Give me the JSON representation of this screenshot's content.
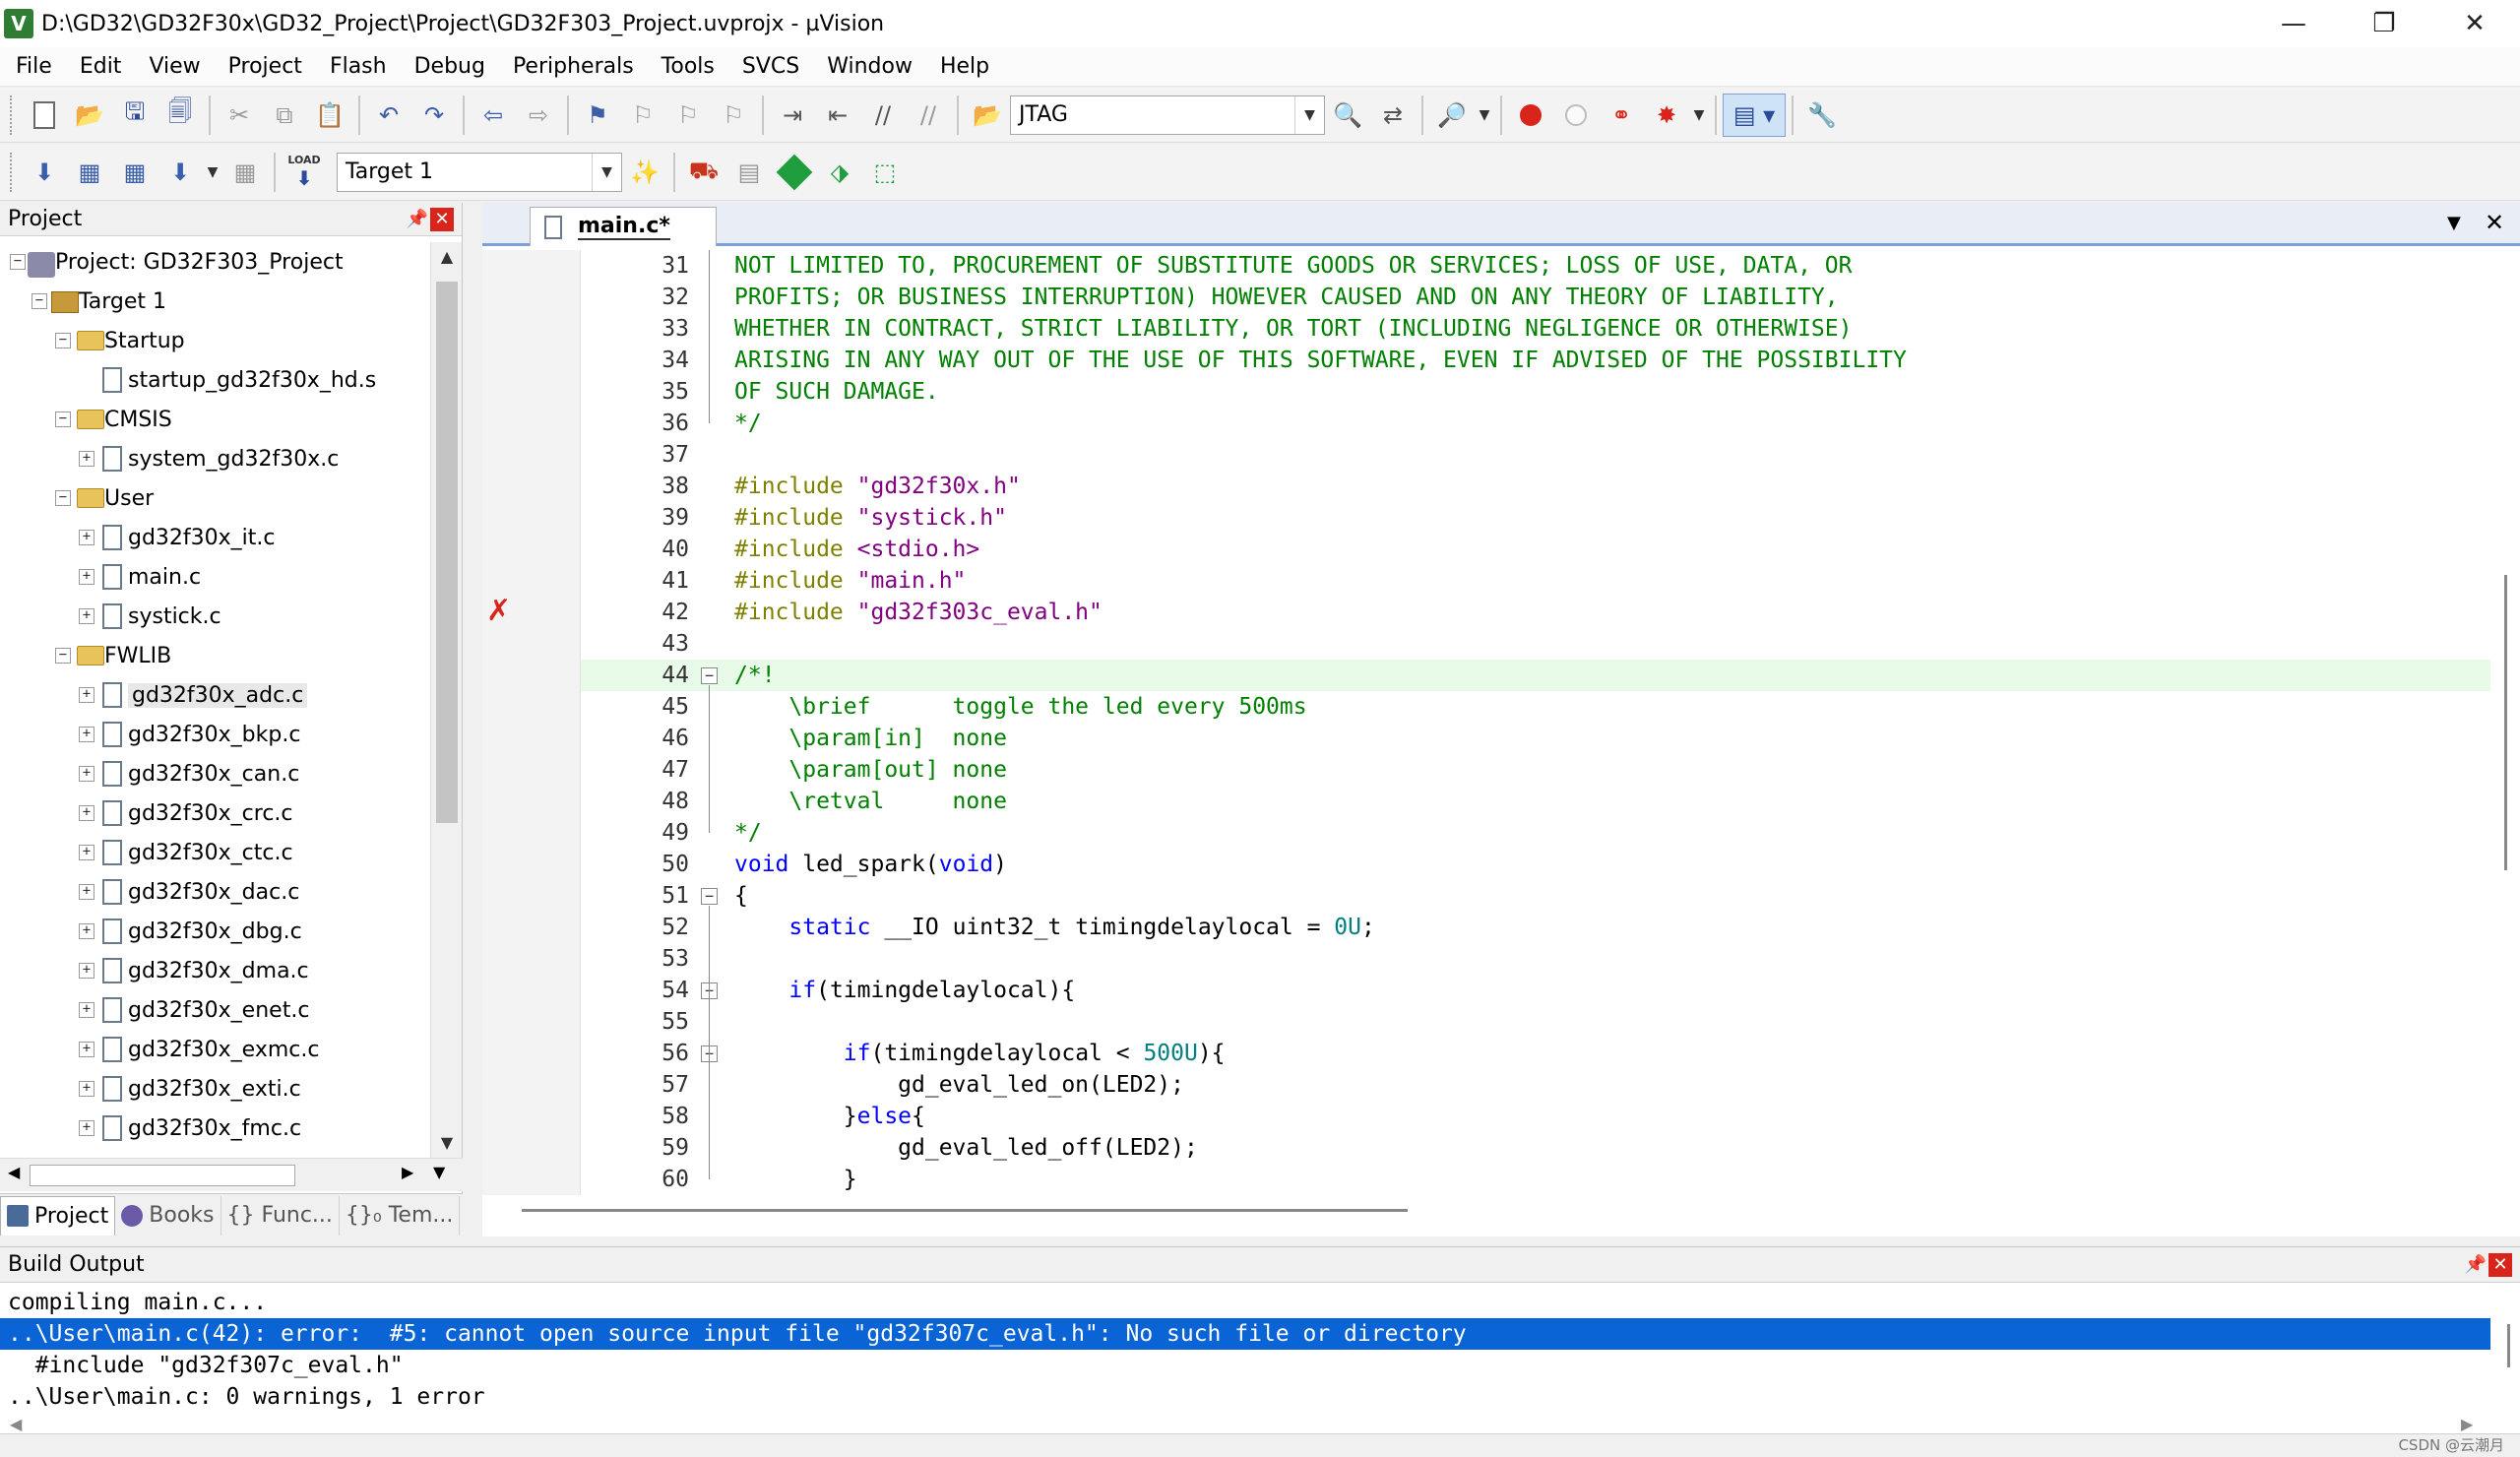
{
  "window": {
    "title": "D:\\GD32\\GD32F30x\\GD32_Project\\Project\\GD32F303_Project.uvprojx - µVision",
    "icon": "V"
  },
  "menu": [
    "File",
    "Edit",
    "View",
    "Project",
    "Flash",
    "Debug",
    "Peripherals",
    "Tools",
    "SVCS",
    "Window",
    "Help"
  ],
  "toolbar": {
    "debug_adapter": "JTAG",
    "target": "Target 1",
    "load_label": "LOAD"
  },
  "project_panel": {
    "title": "Project",
    "tree": [
      {
        "label": "Project: GD32F303_Project",
        "level": 0,
        "kind": "project",
        "exp": "−"
      },
      {
        "label": "Target 1",
        "level": 1,
        "kind": "target",
        "exp": "−"
      },
      {
        "label": "Startup",
        "level": 2,
        "kind": "folder",
        "exp": "−"
      },
      {
        "label": "startup_gd32f30x_hd.s",
        "level": 3,
        "kind": "file",
        "exp": ""
      },
      {
        "label": "CMSIS",
        "level": 2,
        "kind": "folder",
        "exp": "−"
      },
      {
        "label": "system_gd32f30x.c",
        "level": 3,
        "kind": "file",
        "exp": "+"
      },
      {
        "label": "User",
        "level": 2,
        "kind": "folder",
        "exp": "−"
      },
      {
        "label": "gd32f30x_it.c",
        "level": 3,
        "kind": "file",
        "exp": "+"
      },
      {
        "label": "main.c",
        "level": 3,
        "kind": "file",
        "exp": "+"
      },
      {
        "label": "systick.c",
        "level": 3,
        "kind": "file",
        "exp": "+"
      },
      {
        "label": "FWLIB",
        "level": 2,
        "kind": "folder",
        "exp": "−"
      },
      {
        "label": "gd32f30x_adc.c",
        "level": 3,
        "kind": "file",
        "exp": "+",
        "selected": true
      },
      {
        "label": "gd32f30x_bkp.c",
        "level": 3,
        "kind": "file",
        "exp": "+"
      },
      {
        "label": "gd32f30x_can.c",
        "level": 3,
        "kind": "file",
        "exp": "+"
      },
      {
        "label": "gd32f30x_crc.c",
        "level": 3,
        "kind": "file",
        "exp": "+"
      },
      {
        "label": "gd32f30x_ctc.c",
        "level": 3,
        "kind": "file",
        "exp": "+"
      },
      {
        "label": "gd32f30x_dac.c",
        "level": 3,
        "kind": "file",
        "exp": "+"
      },
      {
        "label": "gd32f30x_dbg.c",
        "level": 3,
        "kind": "file",
        "exp": "+"
      },
      {
        "label": "gd32f30x_dma.c",
        "level": 3,
        "kind": "file",
        "exp": "+"
      },
      {
        "label": "gd32f30x_enet.c",
        "level": 3,
        "kind": "file",
        "exp": "+"
      },
      {
        "label": "gd32f30x_exmc.c",
        "level": 3,
        "kind": "file",
        "exp": "+"
      },
      {
        "label": "gd32f30x_exti.c",
        "level": 3,
        "kind": "file",
        "exp": "+"
      },
      {
        "label": "gd32f30x_fmc.c",
        "level": 3,
        "kind": "file",
        "exp": "+"
      }
    ],
    "tabs": [
      "Project",
      "Books",
      "{} Func...",
      "{}₀ Tem..."
    ]
  },
  "editor": {
    "tab": "main.c*",
    "lines": [
      {
        "n": "31",
        "t": "NOT LIMITED TO, PROCUREMENT OF SUBSTITUTE GOODS OR SERVICES; LOSS OF USE, DATA, OR",
        "c": "comment"
      },
      {
        "n": "32",
        "t": "PROFITS; OR BUSINESS INTERRUPTION) HOWEVER CAUSED AND ON ANY THEORY OF LIABILITY,",
        "c": "comment"
      },
      {
        "n": "33",
        "t": "WHETHER IN CONTRACT, STRICT LIABILITY, OR TORT (INCLUDING NEGLIGENCE OR OTHERWISE)",
        "c": "comment"
      },
      {
        "n": "34",
        "t": "ARISING IN ANY WAY OUT OF THE USE OF THIS SOFTWARE, EVEN IF ADVISED OF THE POSSIBILITY",
        "c": "comment"
      },
      {
        "n": "35",
        "t": "OF SUCH DAMAGE.",
        "c": "comment"
      },
      {
        "n": "36",
        "t": "*/",
        "c": "comment"
      },
      {
        "n": "37",
        "t": "",
        "c": "plain"
      },
      {
        "n": "38",
        "pp": "#include ",
        "s": "\"gd32f30x.h\""
      },
      {
        "n": "39",
        "pp": "#include ",
        "s": "\"systick.h\""
      },
      {
        "n": "40",
        "pp": "#include ",
        "s": "<stdio.h>"
      },
      {
        "n": "41",
        "pp": "#include ",
        "s": "\"main.h\""
      },
      {
        "n": "42",
        "pp": "#include ",
        "s": "\"gd32f303c_eval.h\"",
        "error": true
      },
      {
        "n": "43",
        "t": "",
        "c": "plain"
      },
      {
        "n": "44",
        "t": "/*!",
        "c": "comment",
        "current": true,
        "fold": "−"
      },
      {
        "n": "45",
        "t": "    \\brief      toggle the led every 500ms",
        "c": "comment"
      },
      {
        "n": "46",
        "t": "    \\param[in]  none",
        "c": "comment"
      },
      {
        "n": "47",
        "t": "    \\param[out] none",
        "c": "comment"
      },
      {
        "n": "48",
        "t": "    \\retval     none",
        "c": "comment"
      },
      {
        "n": "49",
        "t": "*/",
        "c": "comment"
      },
      {
        "n": "50",
        "kw": "void",
        "t": " led_spark(",
        "kw2": "void",
        "t2": ")"
      },
      {
        "n": "51",
        "t": "{",
        "c": "plain",
        "fold": "−"
      },
      {
        "n": "52",
        "pre": "    ",
        "kw": "static",
        "t": " __IO uint32_t timingdelaylocal = ",
        "num": "0U",
        "t2": ";"
      },
      {
        "n": "53",
        "t": "",
        "c": "plain"
      },
      {
        "n": "54",
        "pre": "    ",
        "kw": "if",
        "t": "(timingdelaylocal){",
        "fold": "−"
      },
      {
        "n": "55",
        "t": "",
        "c": "plain"
      },
      {
        "n": "56",
        "pre": "        ",
        "kw": "if",
        "t": "(timingdelaylocal < ",
        "num": "500U",
        "t2": "){",
        "fold": "−"
      },
      {
        "n": "57",
        "t": "            gd_eval_led_on(LED2);",
        "c": "plain"
      },
      {
        "n": "58",
        "pre": "        ",
        "t": "}",
        "kw": "else",
        "t2": "{"
      },
      {
        "n": "59",
        "t": "            gd_eval_led_off(LED2);",
        "c": "plain"
      },
      {
        "n": "60",
        "t": "        }",
        "c": "plain"
      }
    ]
  },
  "build_output": {
    "title": "Build Output",
    "lines": [
      {
        "t": "compiling main.c...",
        "sel": false
      },
      {
        "t": "..\\User\\main.c(42): error:  #5: cannot open source input file \"gd32f307c_eval.h\": No such file or directory",
        "sel": true
      },
      {
        "t": "  #include \"gd32f307c_eval.h\"",
        "sel": false
      },
      {
        "t": "..\\User\\main.c: 0 warnings, 1 error",
        "sel": false
      }
    ]
  },
  "watermark": "CSDN @云潮月"
}
